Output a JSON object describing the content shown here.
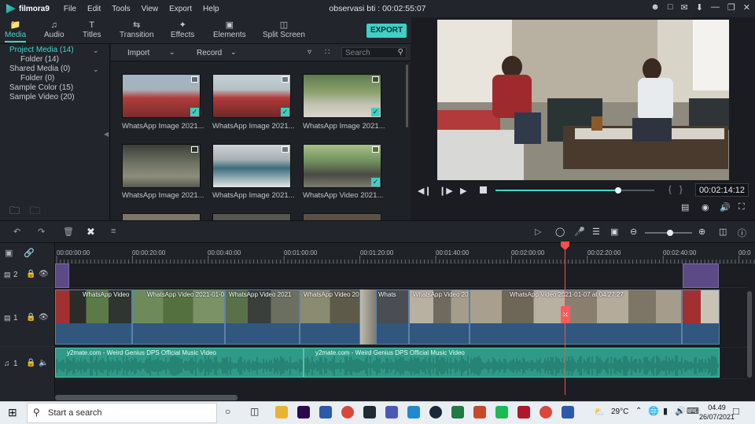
{
  "app": {
    "logo": "filmora9",
    "title": "observasi bti : 00:02:55:07"
  },
  "menu": [
    "File",
    "Edit",
    "Tools",
    "View",
    "Export",
    "Help"
  ],
  "tabs": [
    {
      "label": "Media",
      "icon": "folder-icon",
      "active": true
    },
    {
      "label": "Audio",
      "icon": "music-note-icon"
    },
    {
      "label": "Titles",
      "icon": "text-icon"
    },
    {
      "label": "Transition",
      "icon": "transition-icon"
    },
    {
      "label": "Effects",
      "icon": "sparkle-icon"
    },
    {
      "label": "Elements",
      "icon": "image-icon"
    },
    {
      "label": "Split Screen",
      "icon": "split-screen-icon"
    }
  ],
  "export_label": "EXPORT",
  "library": [
    {
      "label": "Project Media (14)",
      "selected": true
    },
    {
      "label": "Folder (14)"
    },
    {
      "label": "Shared Media (0)"
    },
    {
      "label": "Folder (0)"
    },
    {
      "label": "Sample Color (15)"
    },
    {
      "label": "Sample Video (20)"
    }
  ],
  "media_toolbar": {
    "import": "Import",
    "record": "Record",
    "search_placeholder": "Search"
  },
  "media_items": [
    {
      "caption": "WhatsApp Image 2021...",
      "kind": "image",
      "checked": true
    },
    {
      "caption": "WhatsApp Image 2021...",
      "kind": "image",
      "checked": true
    },
    {
      "caption": "WhatsApp Image 2021...",
      "kind": "image",
      "checked": true
    },
    {
      "caption": "WhatsApp Image 2021...",
      "kind": "image",
      "checked": false
    },
    {
      "caption": "WhatsApp Image 2021...",
      "kind": "image",
      "checked": false
    },
    {
      "caption": "WhatsApp Video 2021...",
      "kind": "video",
      "checked": true
    }
  ],
  "preview": {
    "timecode": "00:02:14:12",
    "progress": 0.77
  },
  "ruler": [
    "00:00:00:00",
    "00:00:20:00",
    "00:00:40:00",
    "00:01:00:00",
    "00:01:20:00",
    "00:01:40:00",
    "00:02:00:00",
    "00:02:20:00",
    "00:02:40:00",
    "00:0"
  ],
  "tracks": {
    "v2": "2",
    "v1": "1",
    "a1": "1"
  },
  "video_clips": [
    {
      "label": "WhatsApp Video 2"
    },
    {
      "label": "WhatsApp Video 2021-01-07"
    },
    {
      "label": "WhatsApp Video 2021"
    },
    {
      "label": "WhatsApp Video 2021"
    },
    {
      "label": "Whats"
    },
    {
      "label": "WhatsApp Video 20"
    },
    {
      "label": "WhatsApp Video 2021-01-07 at 04.27.27"
    }
  ],
  "audio_clips": [
    {
      "label": "y2mate.com - Weird Genius  DPS Official Music Video"
    },
    {
      "label": "y2mate.com - Weird Genius  DPS Official Music Video"
    }
  ],
  "taskbar": {
    "search": "Start a search",
    "weather": "29°C",
    "time": "04.49",
    "date": "26/07/2021"
  }
}
